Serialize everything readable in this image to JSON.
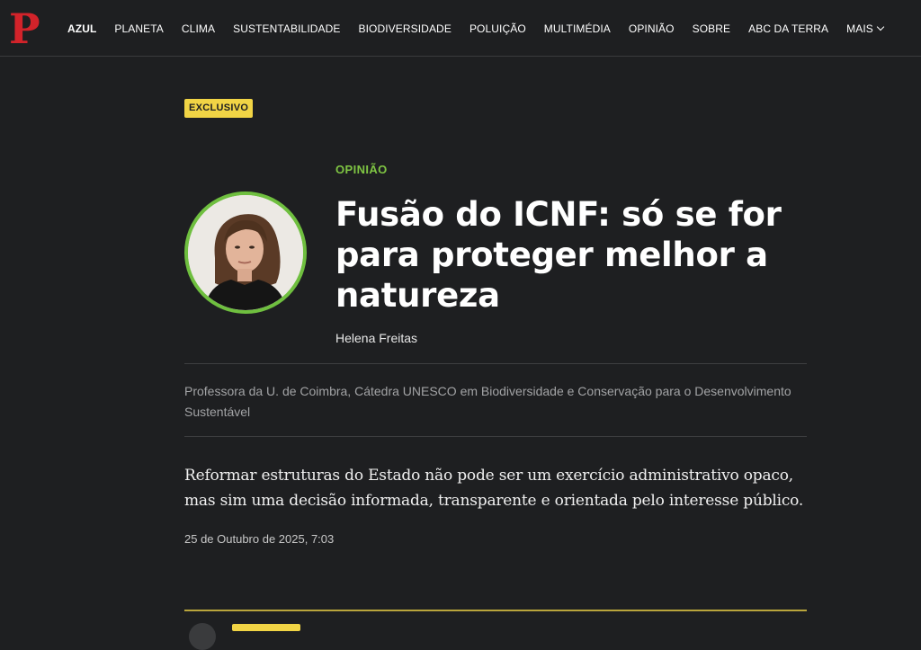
{
  "header": {
    "logo_letter": "P",
    "brand_color": "#d2232a",
    "nav_items": [
      {
        "label": "AZUL",
        "active": true
      },
      {
        "label": "PLANETA"
      },
      {
        "label": "CLIMA"
      },
      {
        "label": "SUSTENTABILIDADE"
      },
      {
        "label": "BIODIVERSIDADE"
      },
      {
        "label": "POLUIÇÃO"
      },
      {
        "label": "MULTIMÉDIA"
      },
      {
        "label": "OPINIÃO"
      },
      {
        "label": "SOBRE"
      },
      {
        "label": "ABC DA TERRA"
      }
    ],
    "more_label": "MAIS",
    "more_icon": "chevron-down-icon"
  },
  "article": {
    "badge": "EXCLUSIVO",
    "badge_color": "#f1d445",
    "kicker": "OPINIÃO",
    "kicker_color": "#7fc543",
    "title": "Fusão do ICNF: só se for para proteger melhor a natureza",
    "author": "Helena Freitas",
    "author_bio": "Professora da U. de Coimbra, Cátedra UNESCO em Biodiversidade e Conservação para o Desenvolvimento Sustentável",
    "lead": "Reformar estruturas do Estado não pode ser um exercício administrativo opaco, mas sim uma decisão informada, transparente e orientada pelo interesse público.",
    "date": "25 de Outubro de 2025, 7:03"
  }
}
